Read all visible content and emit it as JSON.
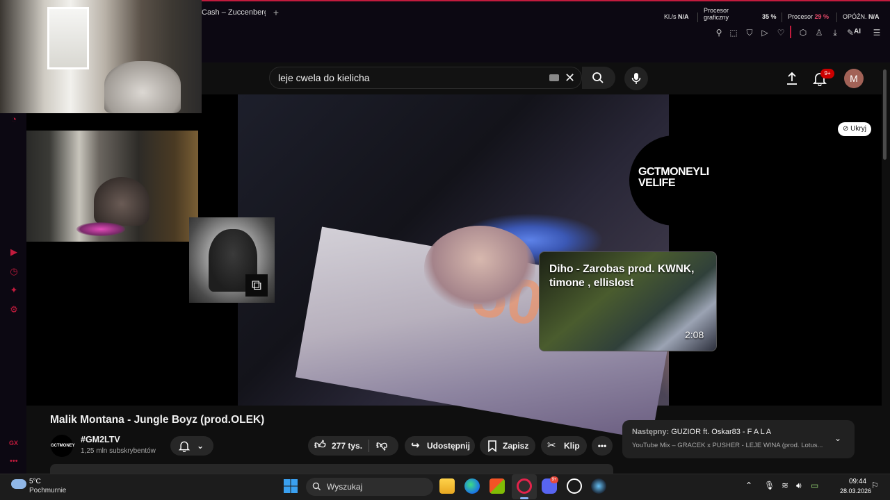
{
  "browser": {
    "tab_title": "Cash – Zuccenberg",
    "new_tab": "+",
    "stats": [
      {
        "label": "Kl./s",
        "value": "N/A"
      },
      {
        "label": "Procesor graficzny",
        "value": "35 %"
      },
      {
        "label": "Procesor",
        "value": "29 %"
      },
      {
        "label": "OPÓŹN.",
        "value": "N/A"
      }
    ],
    "toolbar_icons": [
      "pin-icon",
      "snapshot-icon",
      "shield-icon",
      "play-icon",
      "heart-icon",
      "cube-icon",
      "user-icon",
      "download-icon",
      "ai-icon",
      "menu-icon"
    ],
    "ai_label": "AI"
  },
  "youtube": {
    "search": {
      "query": "leje cwela do kielicha"
    },
    "notifications_badge": "9+",
    "avatar_letter": "M",
    "player": {
      "hide_button": "Ukryj",
      "channel_watermark": "GCTMONEYLIVELIFE",
      "endcard": {
        "title": "Diho - Zarobas prod. KWNK, timone , ellislost",
        "duration": "2:08"
      },
      "note_digit": "50"
    },
    "video": {
      "title": "Malik Montana - Jungle Boyz (prod.OLEK)",
      "channel": "#GM2LTV",
      "subscribers": "1,25 mln subskrybentów",
      "channel_avatar_text": "GCTMONEY",
      "likes": "277 tys.",
      "share_label": "Udostępnij",
      "save_label": "Zapisz",
      "clip_label": "Klip",
      "more_label": "•••"
    },
    "next": {
      "prefix": "Następny:",
      "title": "GUZIOR ft. Oskar83 - F A L A",
      "subtitle": "YouTube Mix – GRACEK x PUSHER - LEJE WINA (prod. Lotus..."
    }
  },
  "sidebar": {
    "gx_label": "GX",
    "more": "•••"
  },
  "taskbar": {
    "weather": {
      "temp": "5°C",
      "desc": "Pochmurnie"
    },
    "search_placeholder": "Wyszukaj",
    "app_badge": "9+",
    "clock": {
      "time": "09:44",
      "date": "28.03.2026"
    }
  },
  "colors": {
    "gx_accent": "#c21b3d",
    "yt_bg": "#0f0f0f",
    "pill": "#272727",
    "badge": "#cc0000"
  }
}
